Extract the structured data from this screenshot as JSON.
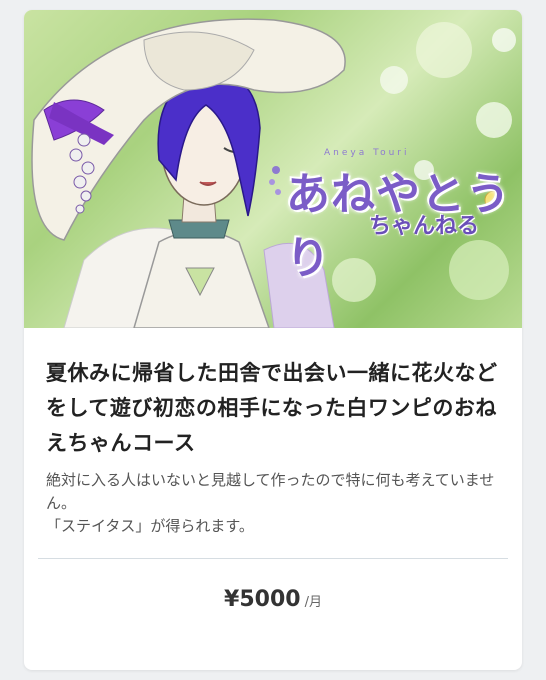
{
  "hero": {
    "logo_main": "あねやとうり",
    "logo_sub": "ちゃんねる",
    "logo_small": "Aneya Touri"
  },
  "plan": {
    "title": "夏休みに帰省した田舎で出会い一緒に花火などをして遊び初恋の相手になった白ワンピのおねえちゃんコース",
    "description": "絶対に入る人はいないと見越して作ったので特に何も考えていません。\n「ステイタス」が得られます。",
    "price": "¥5000",
    "unit": "/月"
  },
  "colors": {
    "logo": "#7b5cc7",
    "hair": "#4b2fc9",
    "ribbon": "#8a3fd6",
    "background": "#eef0f2"
  }
}
